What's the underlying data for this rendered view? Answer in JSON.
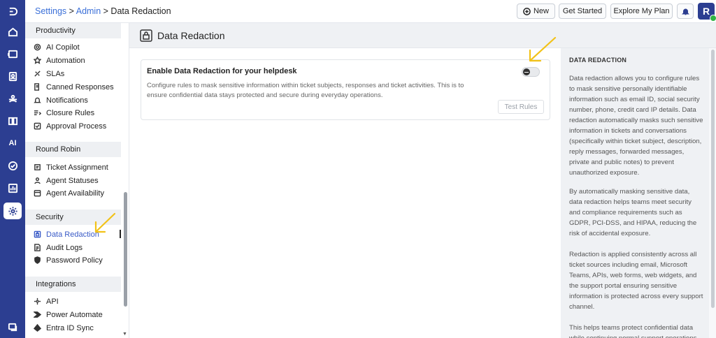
{
  "breadcrumb": {
    "settings": "Settings",
    "sep1": " > ",
    "admin": "Admin",
    "sep2": " > ",
    "current": "Data Redaction"
  },
  "topbar": {
    "new_label": "New",
    "get_started_label": "Get Started",
    "explore_label": "Explore My Plan",
    "avatar_initial": "R"
  },
  "rail": {
    "ai_label": "AI"
  },
  "nav": {
    "productivity": {
      "title": "Productivity",
      "items": [
        "AI Copilot",
        "Automation",
        "SLAs",
        "Canned Responses",
        "Notifications",
        "Closure Rules",
        "Approval Process"
      ]
    },
    "round_robin": {
      "title": "Round Robin",
      "items": [
        "Ticket Assignment",
        "Agent Statuses",
        "Agent Availability"
      ]
    },
    "security": {
      "title": "Security",
      "items": [
        "Data Redaction",
        "Audit Logs",
        "Password Policy"
      ]
    },
    "integrations": {
      "title": "Integrations",
      "items": [
        "API",
        "Power Automate",
        "Entra ID Sync"
      ]
    }
  },
  "page": {
    "title": "Data Redaction"
  },
  "card": {
    "title": "Enable Data Redaction for your helpdesk",
    "description": "Configure rules to mask sensitive information within ticket subjects, responses and ticket activities. This is to ensure confidential data stays protected and secure during everyday operations.",
    "toggle_on": false,
    "test_button": "Test Rules"
  },
  "side_panel": {
    "heading": "DATA REDACTION",
    "paragraphs": [
      "Data redaction allows you to configure rules to mask sensitive personally identifiable information such as email ID, social security number, phone, credit card IP details. Data redaction automatically masks such sensitive information in tickets and conversations (specifically within ticket subject, description, reply messages, forwarded messages, private and public notes) to prevent unauthorized exposure.",
      "By automatically masking sensitive data, data redaction helps teams meet security and compliance requirements such as GDPR, PCI-DSS, and HIPAA, reducing the risk of accidental exposure.",
      "Redaction is applied consistently across all ticket sources including email, Microsoft Teams, APIs, web forms, web widgets, and the support portal ensuring sensitive information is protected across every support channel.",
      "This helps teams protect confidential data while continuing normal support operations."
    ]
  },
  "colors": {
    "rail": "#2c3e91",
    "accent": "#3a5bc7",
    "highlight_arrow": "#f2c218",
    "status_online": "#2fb344"
  }
}
